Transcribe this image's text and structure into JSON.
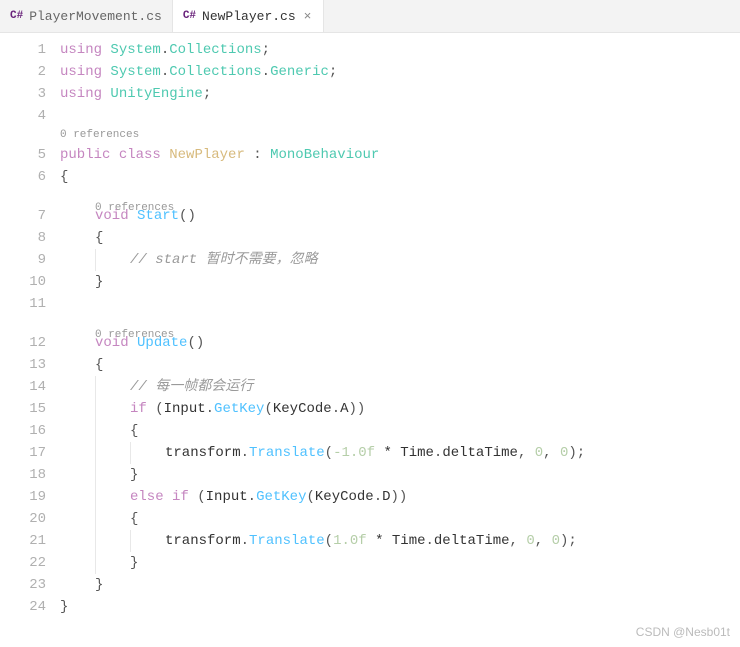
{
  "tabs": [
    {
      "icon": "C#",
      "label": "PlayerMovement.cs",
      "active": false,
      "close": ""
    },
    {
      "icon": "C#",
      "label": "NewPlayer.cs",
      "active": true,
      "close": "×"
    }
  ],
  "codelens": {
    "refs": "0 references"
  },
  "lines": {
    "n1": "1",
    "n2": "2",
    "n3": "3",
    "n4": "4",
    "n5": "5",
    "n6": "6",
    "n7": "7",
    "n8": "8",
    "n9": "9",
    "n10": "10",
    "n11": "11",
    "n12": "12",
    "n13": "13",
    "n14": "14",
    "n15": "15",
    "n16": "16",
    "n17": "17",
    "n18": "18",
    "n19": "19",
    "n20": "20",
    "n21": "21",
    "n22": "22",
    "n23": "23",
    "n24": "24"
  },
  "tok": {
    "using": "using",
    "System": "System",
    "Collections": "Collections",
    "Generic": "Generic",
    "UnityEngine": "UnityEngine",
    "public": "public",
    "class": "class",
    "NewPlayer": "NewPlayer",
    "MonoBehaviour": "MonoBehaviour",
    "void": "void",
    "Start": "Start",
    "Update": "Update",
    "comment_start": "// start 暂时不需要，忽略",
    "comment_update": "// 每一帧都会运行",
    "if": "if",
    "else": "else",
    "Input": "Input",
    "GetKey": "GetKey",
    "KeyCode": "KeyCode",
    "A": "A",
    "D": "D",
    "transform": "transform",
    "Translate": "Translate",
    "Time": "Time",
    "deltaTime": "deltaTime",
    "neg1f": "-1.0f",
    "pos1f": "1.0f",
    "zero": "0",
    "star": " * ",
    "dot": ".",
    "semi": ";",
    "colon": " : ",
    "comma": ", ",
    "sp": " ",
    "lb": "{",
    "rb": "}",
    "lp": "(",
    "rp": ")"
  },
  "watermark": "CSDN @Nesb01t"
}
